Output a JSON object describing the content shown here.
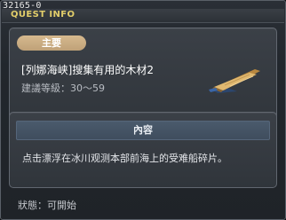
{
  "window": {
    "quest_id": "32165-0",
    "title": "QUEST INFO"
  },
  "quest": {
    "category": "主要",
    "name": "[列娜海峡]搜集有用的木材2",
    "level_label": "建議等級：30～59",
    "icon": "wood-planks-icon"
  },
  "content": {
    "header": "內容",
    "description": "点击漂浮在冰川观测本部前海上的受难船碎片。"
  },
  "status": {
    "text": "狀態：可開始"
  },
  "colors": {
    "title": "#e2ce6a",
    "badge": "#c9ab80",
    "section_header": "#455466"
  }
}
